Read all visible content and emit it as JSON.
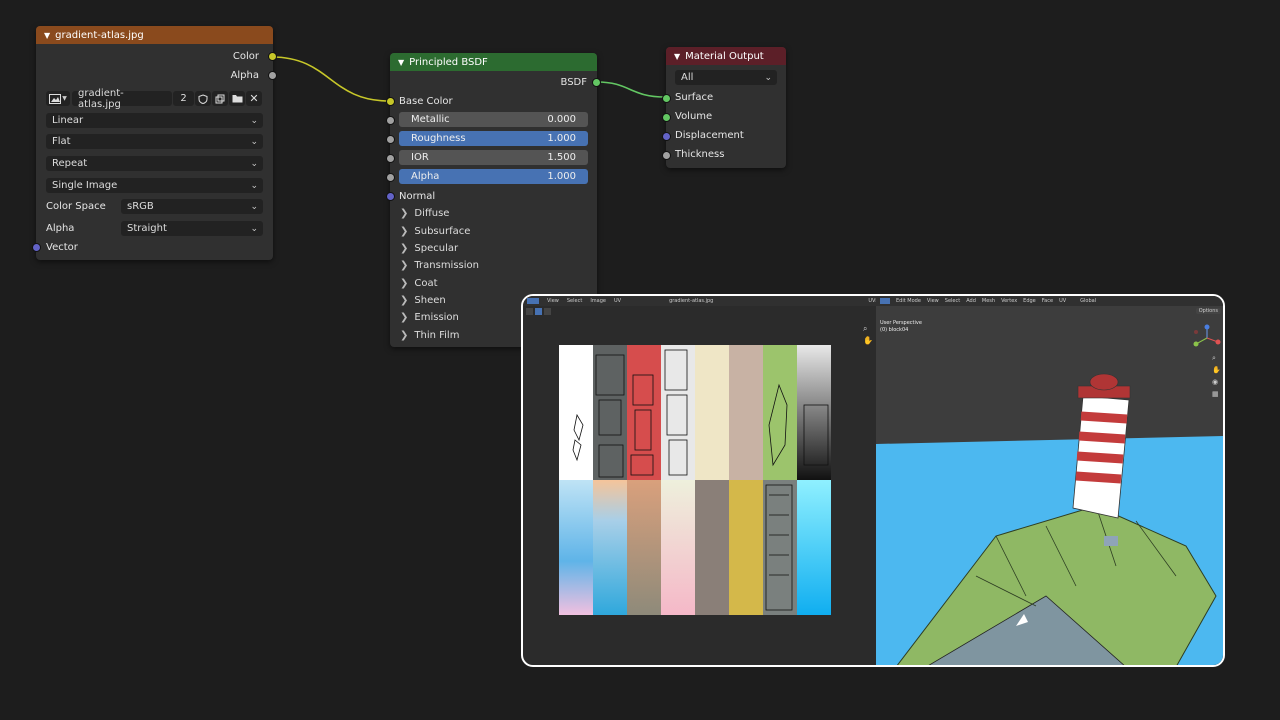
{
  "image_node": {
    "title": "gradient-atlas.jpg",
    "outputs": [
      "Color",
      "Alpha"
    ],
    "image_name": "gradient-atlas.jpg",
    "users": "2",
    "interpolation": "Linear",
    "projection": "Flat",
    "extension": "Repeat",
    "source": "Single Image",
    "color_space_label": "Color Space",
    "color_space": "sRGB",
    "alpha_label": "Alpha",
    "alpha": "Straight",
    "vector_label": "Vector",
    "header_color": "#8a4a1d"
  },
  "bsdf_node": {
    "title": "Principled BSDF",
    "output": "BSDF",
    "base_color": "Base Color",
    "metallic_label": "Metallic",
    "metallic": "0.000",
    "roughness_label": "Roughness",
    "roughness": "1.000",
    "ior_label": "IOR",
    "ior": "1.500",
    "alpha_label": "Alpha",
    "alpha": "1.000",
    "normal": "Normal",
    "panels": [
      "Diffuse",
      "Subsurface",
      "Specular",
      "Transmission",
      "Coat",
      "Sheen",
      "Emission",
      "Thin Film"
    ],
    "header_color": "#2c6b30"
  },
  "output_node": {
    "title": "Material Output",
    "target": "All",
    "inputs": [
      "Surface",
      "Volume",
      "Displacement",
      "Thickness"
    ],
    "header_color": "#5c1f28"
  },
  "inset": {
    "image_editor_menus": [
      "View",
      "Select",
      "Image",
      "UV"
    ],
    "image_editor_file": "gradient-atlas.jpg",
    "viewport_mode": "Edit Mode",
    "viewport_menus": [
      "View",
      "Select",
      "Add",
      "Mesh",
      "Vertex",
      "Edge",
      "Face",
      "UV"
    ],
    "transform_orientation": "Global",
    "options": "Options",
    "overlay_title": "User Perspective",
    "overlay_object": "(0) block04",
    "uvs_label": "UVs"
  },
  "colors": {
    "socket_yellow": "#c7c729",
    "socket_gray": "#a1a1a1",
    "socket_purple": "#6363c7",
    "socket_green": "#63c763",
    "slider_blue": "#4772b3"
  }
}
